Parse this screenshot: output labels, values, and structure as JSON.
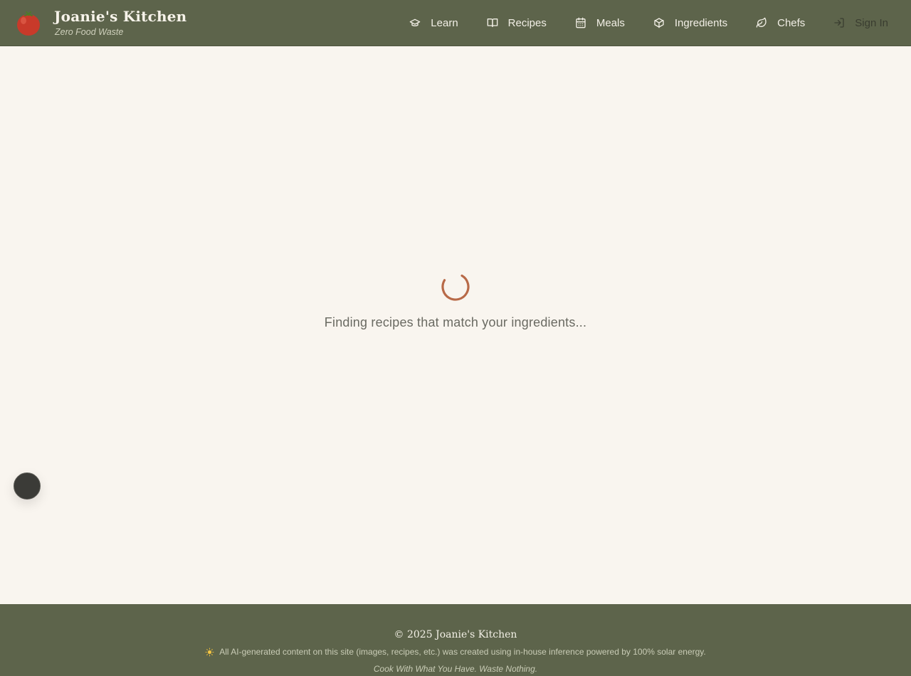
{
  "header": {
    "title": "Joanie's Kitchen",
    "tagline": "Zero Food Waste",
    "logo_icon": "tomato-icon",
    "nav": [
      {
        "label": "Learn",
        "icon": "graduation-cap-icon"
      },
      {
        "label": "Recipes",
        "icon": "book-open-icon"
      },
      {
        "label": "Meals",
        "icon": "calendar-icon"
      },
      {
        "label": "Ingredients",
        "icon": "package-icon"
      },
      {
        "label": "Chefs",
        "icon": "leaf-icon"
      },
      {
        "label": "Sign In",
        "icon": "log-in-icon"
      }
    ]
  },
  "main": {
    "loading_text": "Finding recipes that match your ingredients...",
    "spinner_icon": "loading-spinner-icon"
  },
  "footer": {
    "copyright": "© 2025 Joanie's Kitchen",
    "disclaimer": "All AI-generated content on this site (images, recipes, etc.) was created using in-house inference powered by 100% solar energy.",
    "disclaimer_icon": "sun-icon",
    "motto": "Cook With What You Have. Waste Nothing."
  },
  "colors": {
    "header_bg": "#5d644b",
    "page_bg": "#f9f5ef",
    "spinner": "#b86a48",
    "tomato": "#c83a2a"
  }
}
